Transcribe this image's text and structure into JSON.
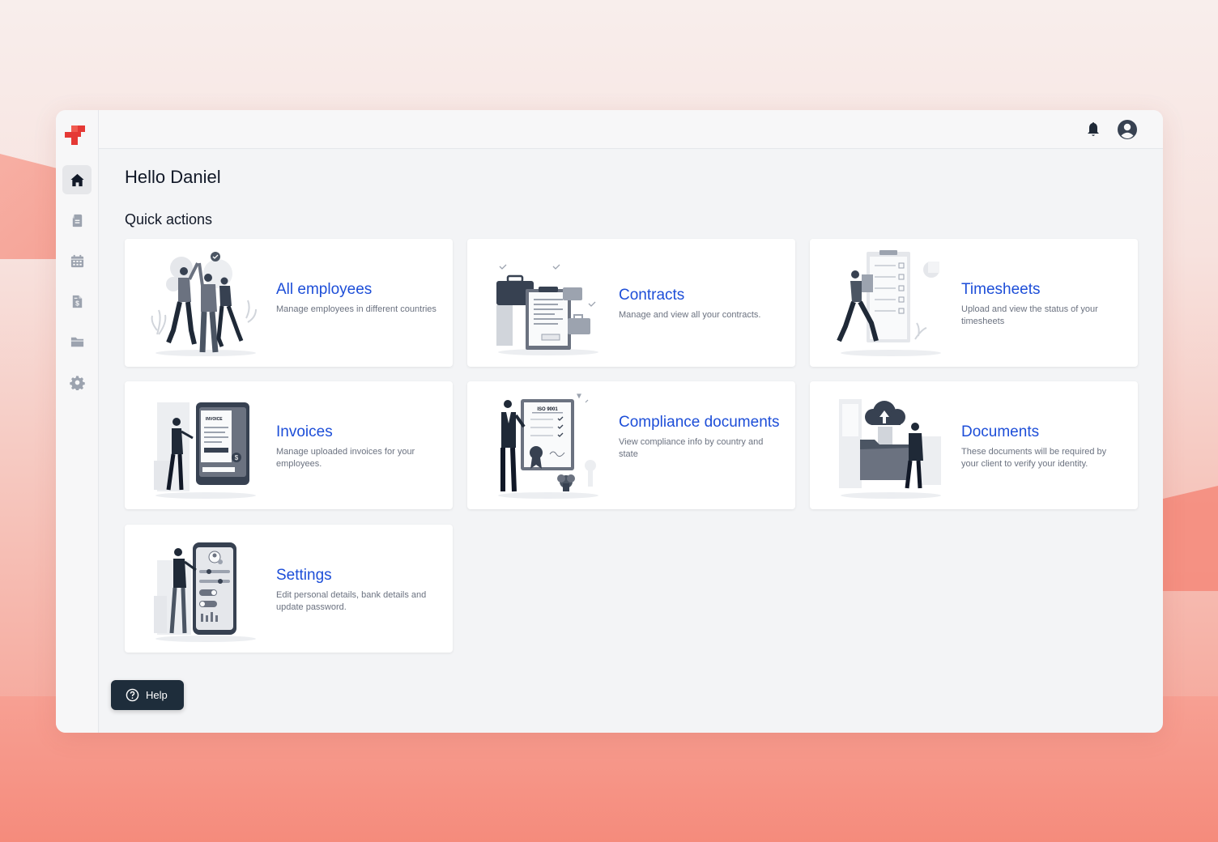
{
  "header": {
    "greeting": "Hello Daniel"
  },
  "quick_actions": {
    "title": "Quick actions",
    "cards": [
      {
        "title": "All employees",
        "description": "Manage employees in different countries",
        "illustration": "team-high-five-illustration"
      },
      {
        "title": "Contracts",
        "description": "Manage and view all your contracts.",
        "illustration": "contract-briefcase-illustration"
      },
      {
        "title": "Timesheets",
        "description": "Upload and view the status of your timesheets",
        "illustration": "timesheet-checklist-illustration"
      },
      {
        "title": "Invoices",
        "description": "Manage uploaded invoices for your employees.",
        "illustration": "invoice-phone-illustration"
      },
      {
        "title": "Compliance documents",
        "description": "View compliance info by country and state",
        "illustration": "iso-certificate-illustration",
        "certificate_label": "ISO 9001"
      },
      {
        "title": "Documents",
        "description": "These documents will be required by your client to verify your identity.",
        "illustration": "cloud-folder-illustration"
      },
      {
        "title": "Settings",
        "description": "Edit personal details, bank details and update password.",
        "illustration": "phone-settings-illustration"
      }
    ]
  },
  "sidebar": {
    "items": [
      {
        "name": "home",
        "icon": "home-icon",
        "active": true
      },
      {
        "name": "documents",
        "icon": "document-icon",
        "active": false
      },
      {
        "name": "calendar",
        "icon": "calendar-icon",
        "active": false
      },
      {
        "name": "invoices",
        "icon": "invoice-dollar-icon",
        "active": false
      },
      {
        "name": "folders",
        "icon": "folder-icon",
        "active": false
      },
      {
        "name": "settings",
        "icon": "gear-icon",
        "active": false
      }
    ]
  },
  "topbar": {
    "icons": [
      "bell-icon",
      "user-avatar-icon"
    ]
  },
  "help": {
    "label": "Help",
    "icon": "question-circle-icon"
  },
  "colors": {
    "brand": "#ee3b3b",
    "link": "#1d4ed8",
    "dark": "#1e2d3b",
    "bg": "#f3f4f6"
  }
}
